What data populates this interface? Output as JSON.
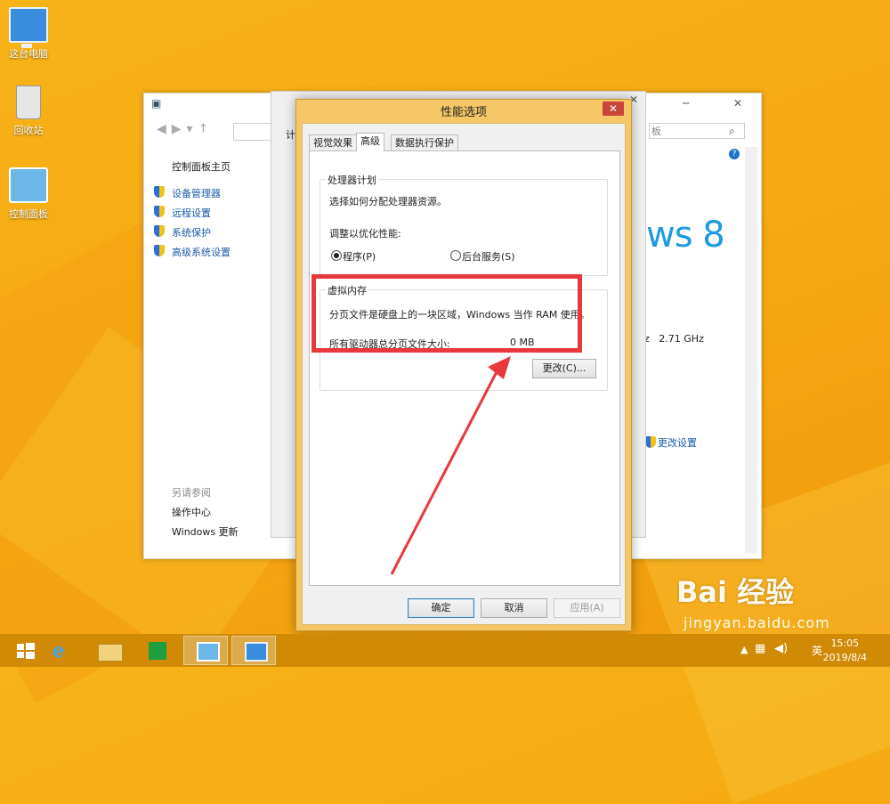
{
  "desktop": {
    "icons": [
      {
        "label": "这台电脑",
        "icon": "computer-icon"
      },
      {
        "label": "回收站",
        "icon": "recycle-bin-icon"
      },
      {
        "label": "控制面板",
        "icon": "control-panel-icon"
      }
    ]
  },
  "system_window": {
    "sidebar": {
      "home": "控制面板主页",
      "links": [
        "设备管理器",
        "远程设置",
        "系统保护",
        "高级系统设置"
      ],
      "see_also_title": "另请参阅",
      "see_also": [
        "操作中心",
        "Windows 更新"
      ]
    },
    "partial_tab": "计",
    "search_placeholder": "板",
    "brand": "ws 8",
    "cpu_freq_prefix": "z",
    "cpu_freq": "2.71 GHz",
    "change_settings": "更改设置",
    "help_icon": "help-icon"
  },
  "dialog": {
    "title": "性能选项",
    "close": "✕",
    "tabs": [
      "视觉效果",
      "高级",
      "数据执行保护"
    ],
    "active_tab": "高级",
    "processor": {
      "group_title": "处理器计划",
      "description": "选择如何分配处理器资源。",
      "adjust_label": "调整以优化性能:",
      "option_programs": "程序(P)",
      "option_services": "后台服务(S)",
      "selected": "程序(P)"
    },
    "virtual_memory": {
      "group_title": "虚拟内存",
      "description": "分页文件是硬盘上的一块区域，Windows 当作 RAM 使用。",
      "total_label": "所有驱动器总分页文件大小:",
      "total_value": "0 MB",
      "change_button": "更改(C)..."
    },
    "buttons": {
      "ok": "确定",
      "cancel": "取消",
      "apply": "应用(A)"
    }
  },
  "taskbar": {
    "tray_lang": "英",
    "time": "15:05",
    "date": "2019/8/4"
  },
  "watermark": {
    "brand": "Bai 经验",
    "url": "jingyan.baidu.com"
  },
  "colors": {
    "highlight": "#e8383d",
    "accent": "#1e9ae0",
    "desktop": "#f5a811"
  }
}
